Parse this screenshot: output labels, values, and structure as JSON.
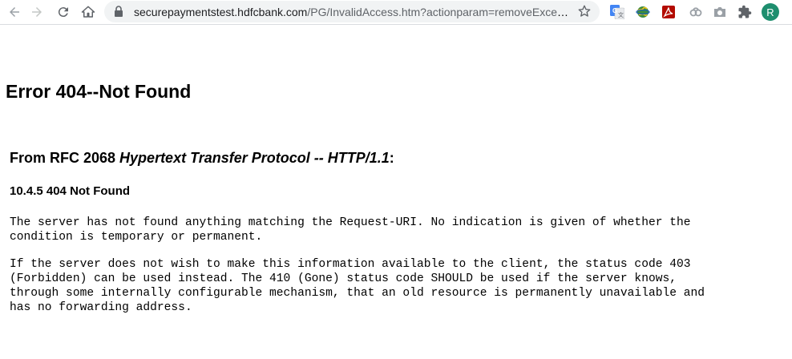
{
  "browser": {
    "url_host": "securepaymentstest.hdfcbank.com",
    "url_path": "/PG/InvalidAccess.htm?actionparam=removeExcept...",
    "profile_initial": "R",
    "icons": [
      "back-icon",
      "forward-icon",
      "reload-icon",
      "home-icon",
      "lock-icon",
      "star-icon",
      "google-translate-icon",
      "extension-globe-icon",
      "adobe-acrobat-icon",
      "extension-link-icon",
      "camera-icon",
      "puzzle-extensions-icon"
    ]
  },
  "page": {
    "heading": "Error 404--Not Found",
    "rfc_prefix": "From RFC 2068 ",
    "rfc_title": "Hypertext Transfer Protocol -- HTTP/1.1",
    "rfc_suffix": ":",
    "section": "10.4.5 404 Not Found",
    "para1_line1": "The server has not found anything matching the Request-URI. No indication is given of whether the",
    "para1_line2": "condition is temporary or permanent.",
    "para2_line1": "If the server does not wish to make this information available to the client, the status code 403",
    "para2_line2": "(Forbidden) can be used instead. The 410 (Gone) status code SHOULD be used if the server knows,",
    "para2_line3": "through some internally configurable mechanism, that an old resource is permanently unavailable and",
    "para2_line4": "has no forwarding address."
  }
}
